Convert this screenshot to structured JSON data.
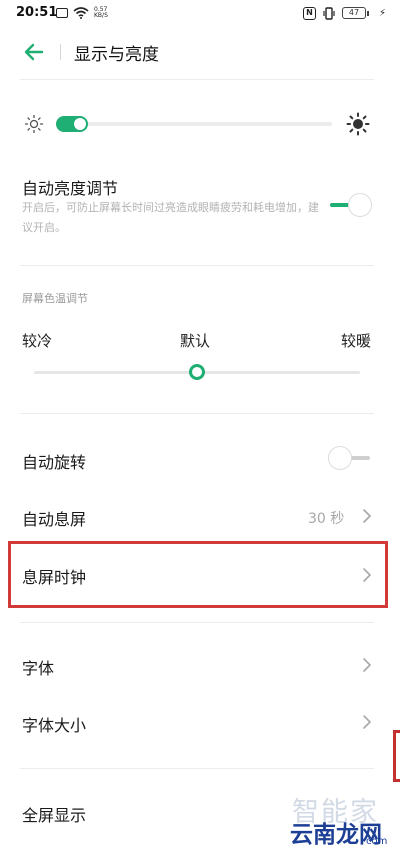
{
  "status_bar": {
    "time": "20:51",
    "network_speed_value": "0.57",
    "network_speed_unit": "KB/S",
    "nfc_label": "N",
    "battery_level": "47"
  },
  "header": {
    "title": "显示与亮度"
  },
  "brightness": {
    "level": 0.1,
    "accent_color": "#1fae73"
  },
  "auto_brightness": {
    "title": "自动亮度调节",
    "description": "开启后，可防止屏幕长时间过亮造成眼睛疲劳和耗电增加，建议开启。",
    "enabled": true
  },
  "color_temperature": {
    "section_label": "屏幕色温调节",
    "cool_label": "较冷",
    "default_label": "默认",
    "warm_label": "较暖",
    "level": 0.5
  },
  "auto_rotate": {
    "title": "自动旋转",
    "enabled": false
  },
  "screen_timeout": {
    "title": "自动息屏",
    "value": "30 秒"
  },
  "aod_clock": {
    "title": "息屏时钟"
  },
  "font": {
    "title": "字体"
  },
  "font_size": {
    "title": "字体大小"
  },
  "fullscreen": {
    "title": "全屏显示"
  },
  "watermark": {
    "top_text": "智能家",
    "brand": "云南龙网",
    "domain": "com"
  },
  "icons": [
    "back-arrow-icon",
    "sun-small-icon",
    "sun-large-icon",
    "chevron-right-icon",
    "wifi-icon",
    "signal-icon",
    "nfc-icon",
    "battery-icon",
    "charging-icon"
  ]
}
